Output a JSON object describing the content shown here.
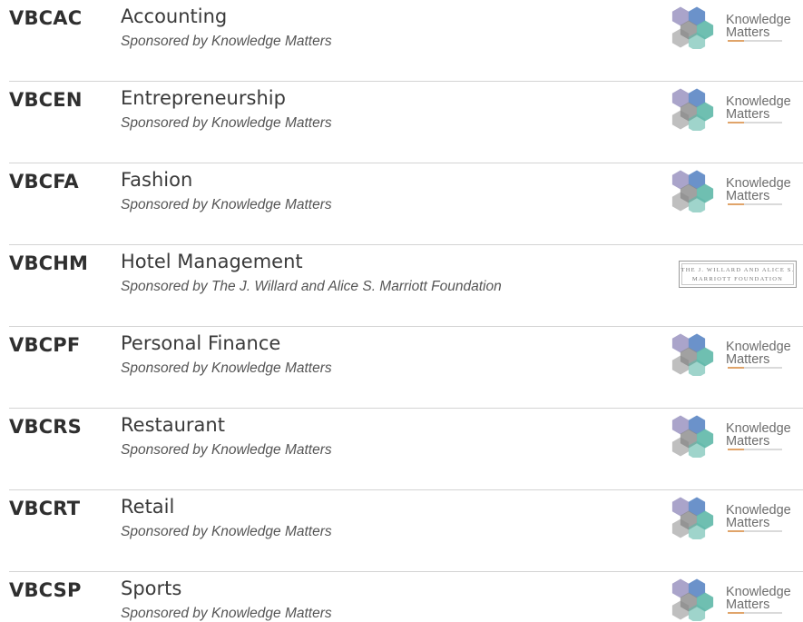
{
  "events": [
    {
      "code": "VBCAC",
      "title": "Accounting",
      "sponsor": "Sponsored by Knowledge Matters",
      "logo": "knowledge-matters"
    },
    {
      "code": "VBCEN",
      "title": "Entrepreneurship",
      "sponsor": "Sponsored by Knowledge Matters",
      "logo": "knowledge-matters"
    },
    {
      "code": "VBCFA",
      "title": "Fashion",
      "sponsor": "Sponsored by Knowledge Matters",
      "logo": "knowledge-matters"
    },
    {
      "code": "VBCHM",
      "title": "Hotel Management",
      "sponsor": "Sponsored by The J. Willard and Alice S. Marriott Foundation",
      "logo": "marriott-foundation"
    },
    {
      "code": "VBCPF",
      "title": "Personal Finance",
      "sponsor": "Sponsored by Knowledge Matters",
      "logo": "knowledge-matters"
    },
    {
      "code": "VBCRS",
      "title": "Restaurant",
      "sponsor": "Sponsored by Knowledge Matters",
      "logo": "knowledge-matters"
    },
    {
      "code": "VBCRT",
      "title": "Retail",
      "sponsor": "Sponsored by Knowledge Matters",
      "logo": "knowledge-matters"
    },
    {
      "code": "VBCSP",
      "title": "Sports",
      "sponsor": "Sponsored by Knowledge Matters",
      "logo": "knowledge-matters"
    }
  ],
  "logos": {
    "knowledge_matters": {
      "line1": "Knowledge",
      "line2": "Matters"
    },
    "marriott_foundation": {
      "line1": "The J. Willard and Alice S.",
      "line2": "Marriott Foundation"
    }
  },
  "colors": {
    "hex_purple": "#8e86b8",
    "hex_blue": "#5b86c4",
    "hex_teal": "#5fb8a8",
    "hex_gray": "#8a8a8a"
  }
}
